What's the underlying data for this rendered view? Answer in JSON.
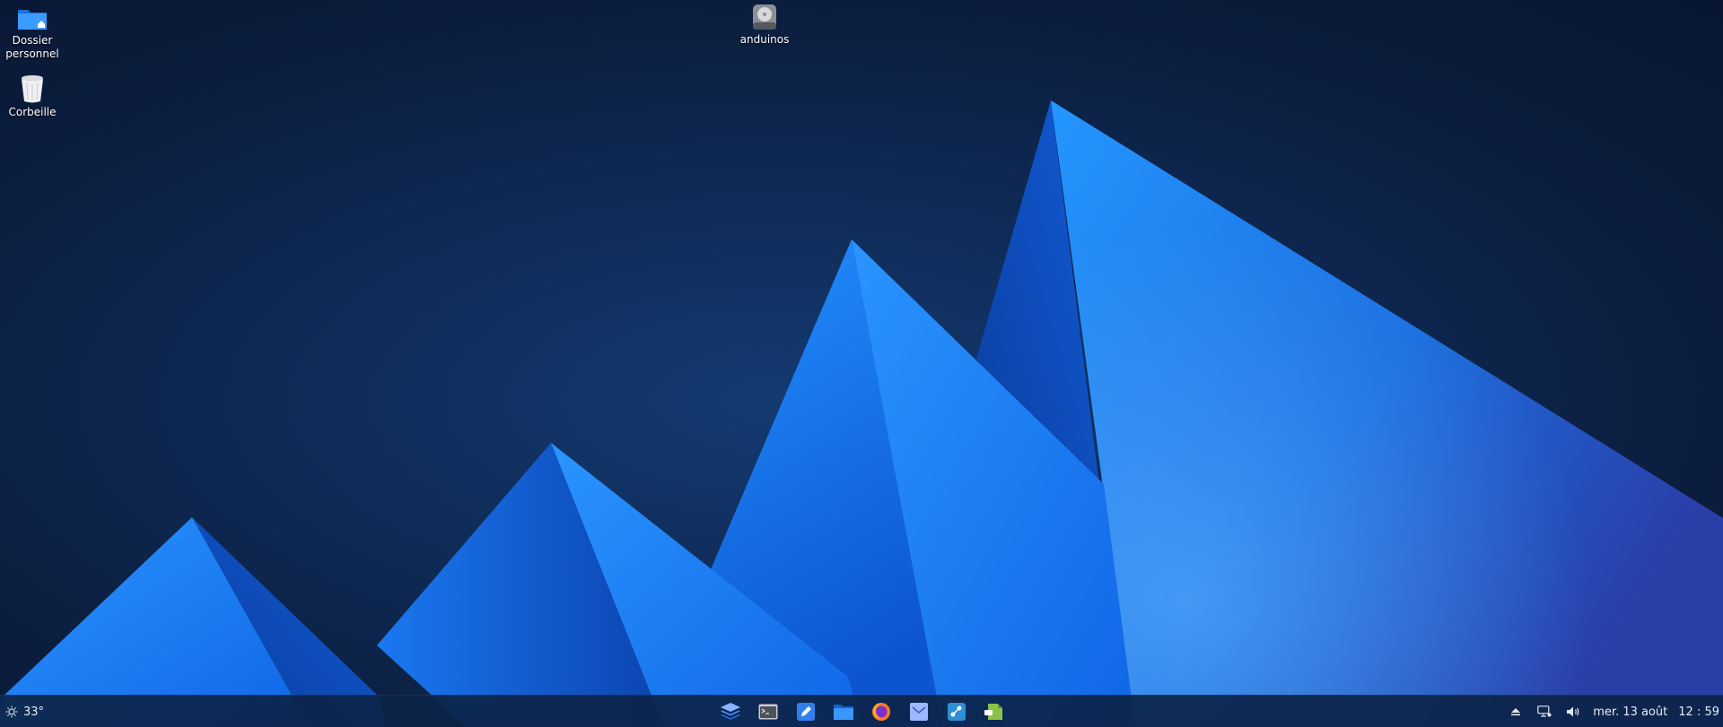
{
  "desktop": {
    "icons": [
      {
        "label_line1": "Dossier",
        "label_line2": "personnel",
        "icon": "home-folder-icon"
      },
      {
        "label": "Corbeille",
        "icon": "trash-icon"
      },
      {
        "label": "anduinos",
        "icon": "drive-icon"
      }
    ]
  },
  "panel": {
    "weather": {
      "temperature": "33°",
      "icon": "sun-icon"
    },
    "taskbar": [
      {
        "name": "stacked-layers-icon"
      },
      {
        "name": "terminal-icon"
      },
      {
        "name": "text-editor-icon"
      },
      {
        "name": "files-icon"
      },
      {
        "name": "firefox-icon"
      },
      {
        "name": "mail-icon"
      },
      {
        "name": "software-center-icon"
      },
      {
        "name": "extension-manager-icon"
      }
    ],
    "tray": {
      "icons": [
        "eject-icon",
        "network-icon",
        "volume-icon"
      ],
      "date": "mer. 13 août",
      "time": "12 : 59"
    }
  },
  "colors": {
    "background": "#0b1d3d",
    "peak_light": "#2a92ff",
    "peak_dark": "#0f4fc0",
    "panel": "#0c2448"
  }
}
